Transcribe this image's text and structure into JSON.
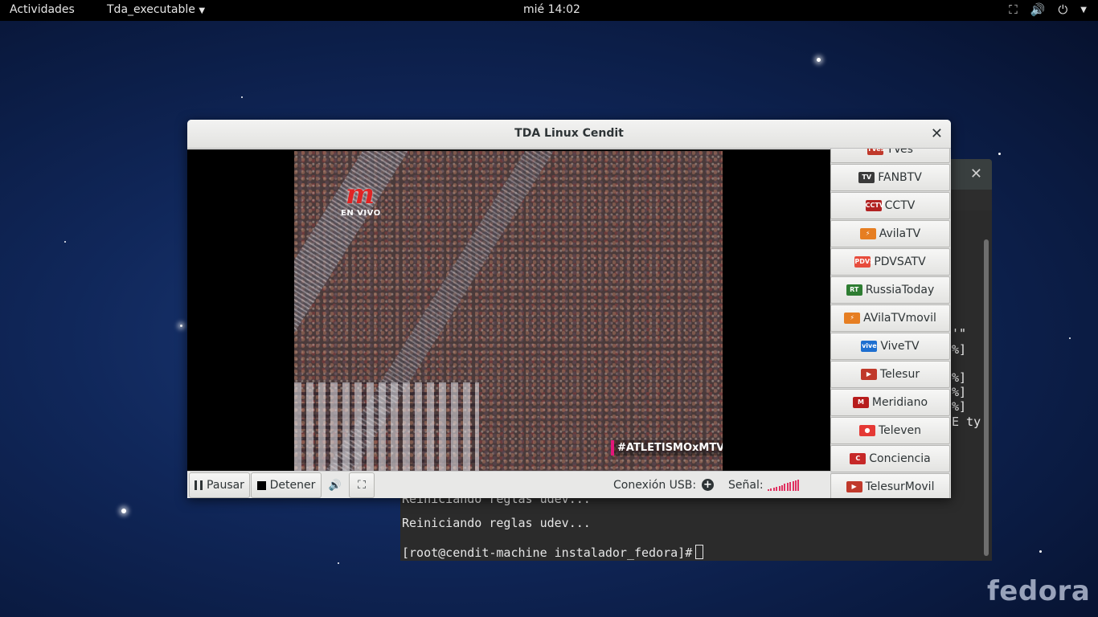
{
  "topbar": {
    "activities": "Actividades",
    "app_menu": "Tda_executable",
    "clock": "mié 14:02"
  },
  "terminal": {
    "fragments": [
      "'\"",
      "%]",
      "%]",
      "%]",
      "%]",
      "E ty"
    ],
    "line_hidden": "Reiniciando reglas udev...",
    "line1": "Reiniciando reglas udev...",
    "prompt": "[root@cendit-machine instalador_fedora]#"
  },
  "tda": {
    "title": "TDA Linux Cendit",
    "video": {
      "logo_text": "EN VIVO",
      "hashtag": "#ATLETISMOxMTV"
    },
    "controls": {
      "pause": "Pausar",
      "stop": "Detener",
      "usb_label": "Conexión USB:",
      "signal_label": "Señal:",
      "signal_level": 0.85
    },
    "channels": [
      {
        "name": "TVes",
        "logo": "TVes",
        "color": "#c0392b"
      },
      {
        "name": "FANBTV",
        "logo": "TV",
        "color": "#3a3a3a"
      },
      {
        "name": "CCTV",
        "logo": "CCTV",
        "color": "#b22222"
      },
      {
        "name": "AvilaTV",
        "logo": "⚡",
        "color": "#e67e22"
      },
      {
        "name": "PDVSATV",
        "logo": "PDVSA",
        "color": "#e74c3c"
      },
      {
        "name": "RussiaToday",
        "logo": "RT",
        "color": "#2e7d32"
      },
      {
        "name": "AVilaTVmovil",
        "logo": "⚡",
        "color": "#e67e22"
      },
      {
        "name": "ViveTV",
        "logo": "vive",
        "color": "#1e6fd0"
      },
      {
        "name": "Telesur",
        "logo": "▶",
        "color": "#c0392b"
      },
      {
        "name": "Meridiano",
        "logo": "M",
        "color": "#b71c1c"
      },
      {
        "name": "Televen",
        "logo": "●",
        "color": "#e53935"
      },
      {
        "name": "Conciencia",
        "logo": "C",
        "color": "#c62828"
      },
      {
        "name": "TelesurMovil",
        "logo": "▶",
        "color": "#c0392b"
      }
    ]
  },
  "desktop": {
    "watermark": "fedora"
  }
}
